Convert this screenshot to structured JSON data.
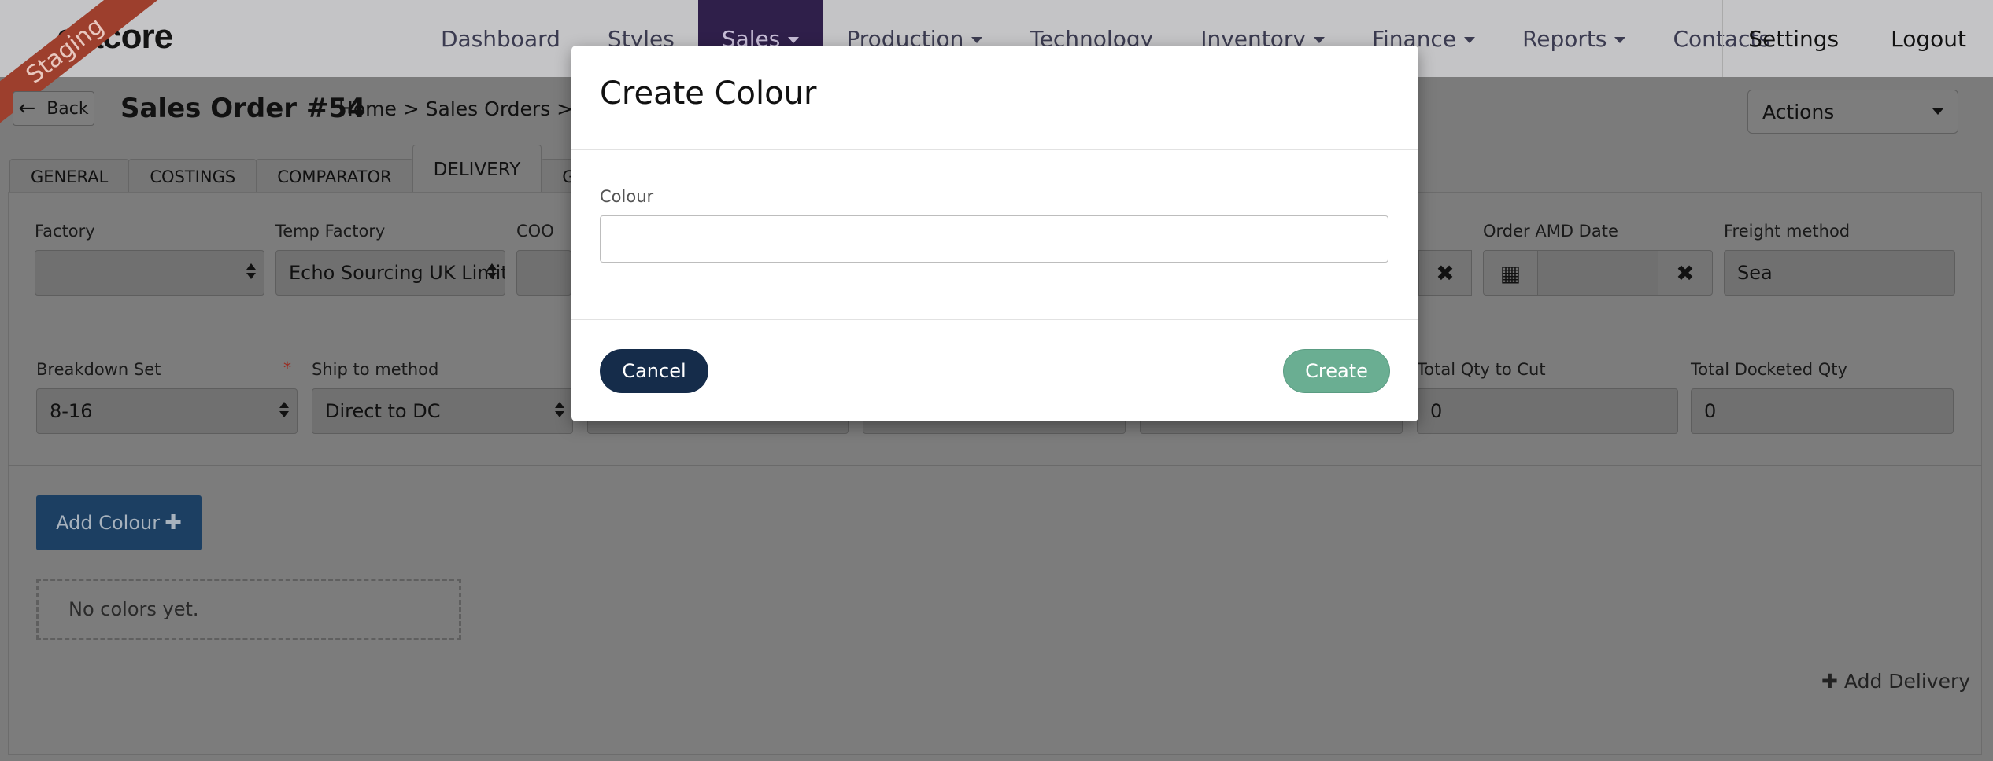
{
  "brand": {
    "logo_text": "elacore",
    "environment_badge": "Staging"
  },
  "nav": {
    "items": [
      {
        "label": "Dashboard",
        "dropdown": false,
        "active": false
      },
      {
        "label": "Styles",
        "dropdown": false,
        "active": false
      },
      {
        "label": "Sales",
        "dropdown": true,
        "active": true
      },
      {
        "label": "Production",
        "dropdown": true,
        "active": false
      },
      {
        "label": "Technology",
        "dropdown": false,
        "active": false
      },
      {
        "label": "Inventory",
        "dropdown": true,
        "active": false
      },
      {
        "label": "Finance",
        "dropdown": true,
        "active": false
      },
      {
        "label": "Reports",
        "dropdown": true,
        "active": false
      },
      {
        "label": "Contacts",
        "dropdown": false,
        "active": false
      }
    ],
    "settings_label": "Settings",
    "logout_label": "Logout"
  },
  "header": {
    "back_label": "Back",
    "title": "Sales Order #54",
    "breadcrumb": "Home > Sales Orders > Sal",
    "actions_label": "Actions"
  },
  "tabs": [
    {
      "label": "GENERAL",
      "active": false
    },
    {
      "label": "COSTINGS",
      "active": false
    },
    {
      "label": "COMPARATOR",
      "active": false
    },
    {
      "label": "DELIVERY",
      "active": true
    },
    {
      "label": "GAL",
      "active": false
    }
  ],
  "row1": {
    "factory_label": "Factory",
    "factory_value": "",
    "temp_factory_label": "Temp Factory",
    "temp_factory_value": "Echo Sourcing UK Limite",
    "coo_label": "COO",
    "order_amd_label": "Order AMD Date",
    "order_amd_value": "",
    "freight_label": "Freight method",
    "freight_value": "Sea"
  },
  "row2": {
    "breakdown_label": "Breakdown Set",
    "breakdown_value": "8-16",
    "required_mark": "*",
    "ship_label": "Ship to method",
    "ship_value": "Direct to DC",
    "total_cut_label": "Total Qty to Cut",
    "total_cut_value": "0",
    "total_docketed_label": "Total Docketed Qty",
    "total_docketed_value": "0"
  },
  "colours": {
    "add_button_label": "Add Colour",
    "add_button_icon": "plus-icon",
    "empty_text": "No colors yet."
  },
  "add_delivery_label": "Add Delivery",
  "modal": {
    "title": "Create Colour",
    "field_label": "Colour",
    "field_value": "",
    "cancel_label": "Cancel",
    "create_label": "Create"
  },
  "colors": {
    "active_nav_bg": "#2f1f4a",
    "ribbon": "#9d3f2d",
    "primary_button": "#1c3f62",
    "cancel_button": "#152c4a",
    "create_button": "#6aae92"
  }
}
